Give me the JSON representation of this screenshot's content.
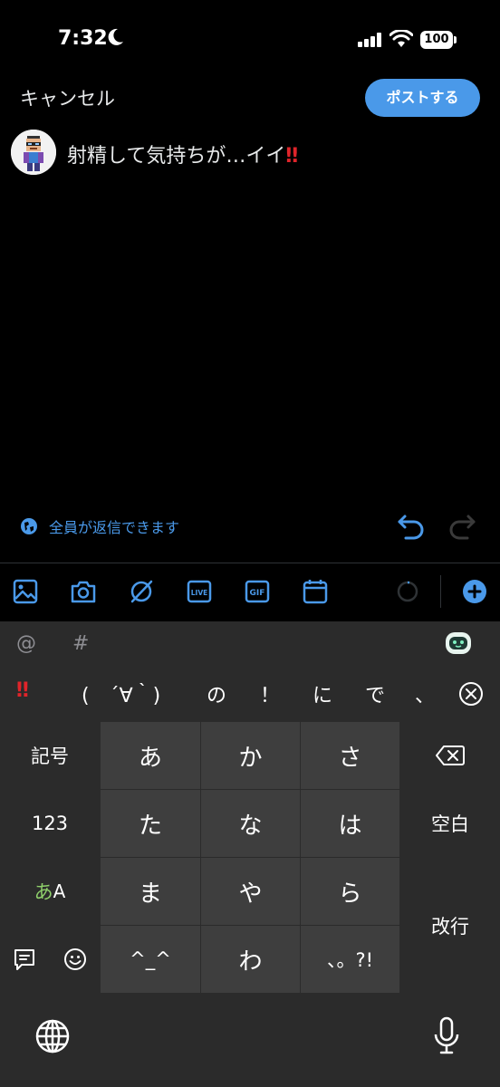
{
  "status_bar": {
    "time": "7:32",
    "battery": "100",
    "icons": [
      "moon-icon",
      "signal-icon",
      "wifi-icon",
      "battery-icon"
    ]
  },
  "compose": {
    "cancel_label": "キャンセル",
    "post_label": "ポストする",
    "text": "射精して気持ちが…イイ",
    "text_emoji": "‼",
    "reply_setting": "全員が返信できます"
  },
  "toolbar": {
    "icons": [
      "image-icon",
      "camera-icon",
      "grok-icon",
      "live-icon",
      "gif-icon",
      "schedule-icon",
      "progress-ring-icon",
      "add-icon"
    ],
    "live_label": "LIVE",
    "gif_label": "GIF"
  },
  "keyboard": {
    "quick": {
      "at": "@",
      "hash": "#"
    },
    "candidates": [
      "‼",
      "(　´∀｀)",
      "の",
      "！",
      "に",
      "で",
      "、"
    ],
    "keys": {
      "symbols": "記号",
      "numbers": "123",
      "kana_a": "あ",
      "kana_a_latin": "A",
      "a": "あ",
      "ka": "か",
      "sa": "さ",
      "ta": "た",
      "na": "な",
      "ha": "は",
      "ma": "ま",
      "ya": "や",
      "ra": "ら",
      "face": "^_^",
      "wa": "わ",
      "punct": "、。?!",
      "space": "空白",
      "enter": "改行"
    },
    "accent_color": "#8fd06b"
  },
  "colors": {
    "accent": "#4a99e9",
    "alert": "#e0242a"
  }
}
